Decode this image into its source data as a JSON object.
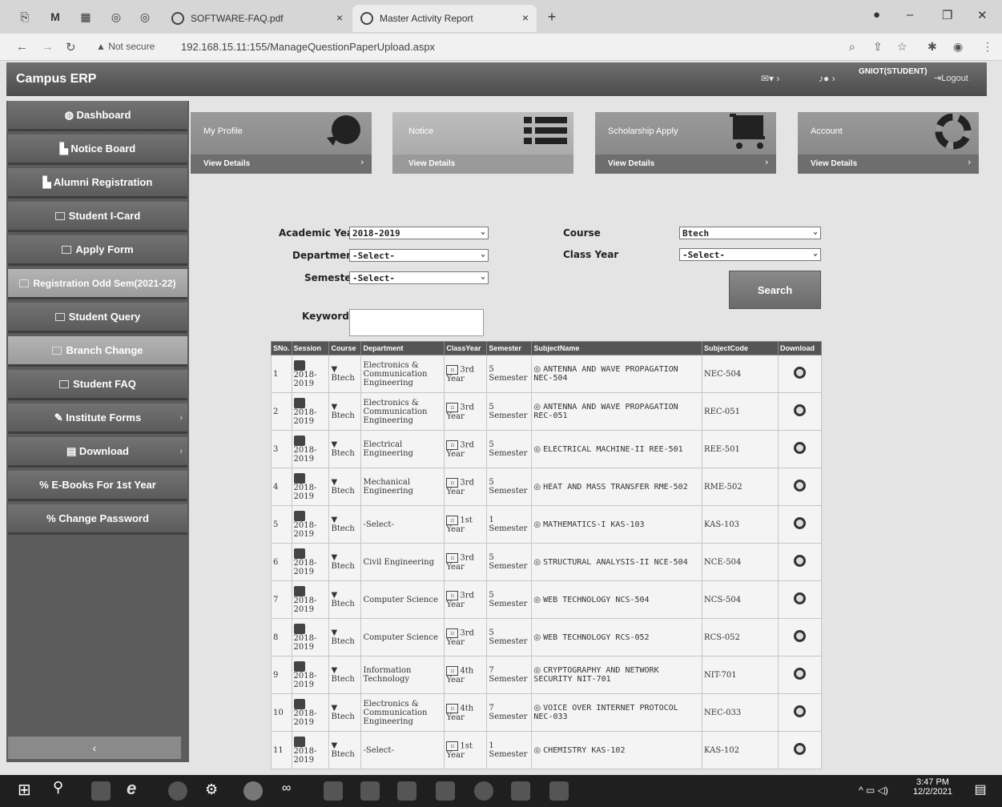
{
  "browser": {
    "tabs": [
      {
        "title": "SOFTWARE-FAQ.pdf",
        "close": "×"
      },
      {
        "title": "Master Activity Report",
        "close": "×"
      }
    ],
    "new_tab": "+",
    "url_warning": "Not secure",
    "url": "192.168.15.11:155/ManageQuestionPaperUpload.aspx"
  },
  "header": {
    "brand": "Campus ERP",
    "user": "GNIOT(STUDENT)",
    "logout": "Logout"
  },
  "sidebar": {
    "items": [
      {
        "label": "Dashboard",
        "icon": "dashboard-icon"
      },
      {
        "label": "Notice Board",
        "icon": "chart-icon"
      },
      {
        "label": "Alumni Registration",
        "icon": "chart-icon"
      },
      {
        "label": "Student I-Card",
        "icon": "table-icon"
      },
      {
        "label": "Apply Form",
        "icon": "table-icon"
      },
      {
        "label": "Registration Odd Sem(2021-22)",
        "icon": "table-icon"
      },
      {
        "label": "Student Query",
        "icon": "table-icon"
      },
      {
        "label": "Branch Change",
        "icon": "table-icon"
      },
      {
        "label": "Student FAQ",
        "icon": "table-icon"
      },
      {
        "label": "Institute Forms",
        "icon": "wrench-icon"
      },
      {
        "label": "Download",
        "icon": "file-icon"
      },
      {
        "label": "E-Books For 1st Year",
        "icon": "link-icon"
      },
      {
        "label": "Change Password",
        "icon": "link-icon"
      }
    ],
    "collapse": "‹"
  },
  "cards": [
    {
      "title": "My Profile",
      "link": "View Details",
      "icon": "chat-bubble-icon"
    },
    {
      "title": "Notice",
      "link": "View Details",
      "icon": "list-icon"
    },
    {
      "title": "Scholarship Apply",
      "link": "View Details",
      "icon": "cart-icon"
    },
    {
      "title": "Account",
      "link": "View Details",
      "icon": "lifebuoy-icon"
    }
  ],
  "filters": {
    "academic_year_label": "Academic Year",
    "academic_year_value": "2018-2019",
    "department_label": "Department",
    "department_value": "-Select-",
    "semester_label": "Semester",
    "semester_value": "-Select-",
    "course_label": "Course",
    "course_value": "Btech",
    "class_year_label": "Class Year",
    "class_year_value": "-Select-",
    "keywords_label": "Keywords",
    "search_button": "Search"
  },
  "table": {
    "headers": [
      "SNo.",
      "Session",
      "Course",
      "Department",
      "ClassYear",
      "Semester",
      "SubjectName",
      "SubjectCode",
      "Download"
    ],
    "rows": [
      {
        "sno": "1",
        "session": "2018-2019",
        "course": "Btech",
        "department": "Electronics & Communication Engineering",
        "class_year": "3rd Year",
        "semester": "5 Semester",
        "subject": "ANTENNA AND WAVE PROPAGATION NEC-504",
        "code": "NEC-504"
      },
      {
        "sno": "2",
        "session": "2018-2019",
        "course": "Btech",
        "department": "Electronics & Communication Engineering",
        "class_year": "3rd Year",
        "semester": "5 Semester",
        "subject": "ANTENNA AND WAVE PROPAGATION REC-051",
        "code": "REC-051"
      },
      {
        "sno": "3",
        "session": "2018-2019",
        "course": "Btech",
        "department": "Electrical Engineering",
        "class_year": "3rd Year",
        "semester": "5 Semester",
        "subject": "ELECTRICAL MACHINE-II REE-501",
        "code": "REE-501"
      },
      {
        "sno": "4",
        "session": "2018-2019",
        "course": "Btech",
        "department": "Mechanical Engineering",
        "class_year": "3rd Year",
        "semester": "5 Semester",
        "subject": "HEAT AND MASS TRANSFER RME-502",
        "code": "RME-502"
      },
      {
        "sno": "5",
        "session": "2018-2019",
        "course": "Btech",
        "department": "-Select-",
        "class_year": "1st Year",
        "semester": "1 Semester",
        "subject": "MATHEMATICS-I KAS-103",
        "code": "KAS-103"
      },
      {
        "sno": "6",
        "session": "2018-2019",
        "course": "Btech",
        "department": "Civil Engineering",
        "class_year": "3rd Year",
        "semester": "5 Semester",
        "subject": "STRUCTURAL ANALYSIS-II NCE-504",
        "code": "NCE-504"
      },
      {
        "sno": "7",
        "session": "2018-2019",
        "course": "Btech",
        "department": "Computer Science",
        "class_year": "3rd Year",
        "semester": "5 Semester",
        "subject": "WEB TECHNOLOGY NCS-504",
        "code": "NCS-504"
      },
      {
        "sno": "8",
        "session": "2018-2019",
        "course": "Btech",
        "department": "Computer Science",
        "class_year": "3rd Year",
        "semester": "5 Semester",
        "subject": "WEB TECHNOLOGY RCS-052",
        "code": "RCS-052"
      },
      {
        "sno": "9",
        "session": "2018-2019",
        "course": "Btech",
        "department": "Information Technology",
        "class_year": "4th Year",
        "semester": "7 Semester",
        "subject": "CRYPTOGRAPHY AND NETWORK SECURITY NIT-701",
        "code": "NIT-701"
      },
      {
        "sno": "10",
        "session": "2018-2019",
        "course": "Btech",
        "department": "Electronics & Communication Engineering",
        "class_year": "4th Year",
        "semester": "7 Semester",
        "subject": "VOICE OVER INTERNET PROTOCOL NEC-033",
        "code": "NEC-033"
      },
      {
        "sno": "11",
        "session": "2018-2019",
        "course": "Btech",
        "department": "-Select-",
        "class_year": "1st Year",
        "semester": "1 Semester",
        "subject": "CHEMISTRY KAS-102",
        "code": "KAS-102"
      }
    ]
  },
  "taskbar": {
    "time": "3:47 PM",
    "date": "12/2/2021"
  }
}
